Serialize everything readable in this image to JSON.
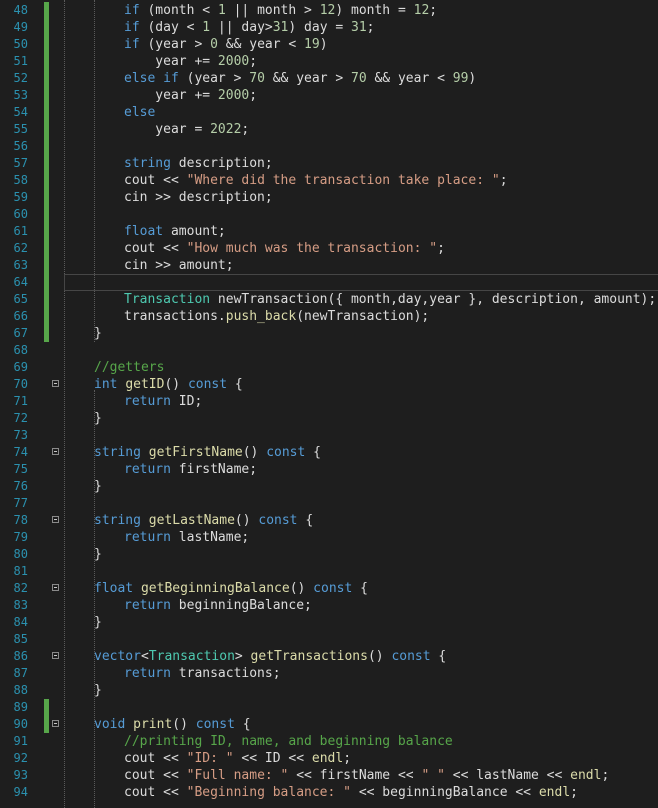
{
  "editor": {
    "colors": {
      "background": "#1e1e1e",
      "line_number": "#2b91af",
      "keyword": "#569cd6",
      "type": "#4ec9b0",
      "function": "#dcdcaa",
      "number": "#b5cea8",
      "string": "#d69d85",
      "comment": "#57a64a",
      "plain": "#dcdcdc",
      "change_bar": "#57a64a"
    },
    "line_numbers": [
      "48",
      "49",
      "50",
      "51",
      "52",
      "53",
      "54",
      "55",
      "56",
      "57",
      "58",
      "59",
      "60",
      "61",
      "62",
      "63",
      "64",
      "65",
      "66",
      "67",
      "68",
      "69",
      "70",
      "71",
      "72",
      "73",
      "74",
      "75",
      "76",
      "77",
      "78",
      "79",
      "80",
      "81",
      "82",
      "83",
      "84",
      "85",
      "86",
      "87",
      "88",
      "89",
      "90",
      "91",
      "92",
      "93",
      "94"
    ],
    "lines": [
      [
        [
          "kw",
          "if"
        ],
        [
          "pl",
          " (month < "
        ],
        [
          "num",
          "1"
        ],
        [
          "pl",
          " || month > "
        ],
        [
          "num",
          "12"
        ],
        [
          "pl",
          ") month = "
        ],
        [
          "num",
          "12"
        ],
        [
          "pl",
          ";"
        ]
      ],
      [
        [
          "kw",
          "if"
        ],
        [
          "pl",
          " (day < "
        ],
        [
          "num",
          "1"
        ],
        [
          "pl",
          " || day>"
        ],
        [
          "num",
          "31"
        ],
        [
          "pl",
          ") day = "
        ],
        [
          "num",
          "31"
        ],
        [
          "pl",
          ";"
        ]
      ],
      [
        [
          "kw",
          "if"
        ],
        [
          "pl",
          " (year > "
        ],
        [
          "num",
          "0"
        ],
        [
          "pl",
          " && year < "
        ],
        [
          "num",
          "19"
        ],
        [
          "pl",
          ")"
        ]
      ],
      [
        [
          "pl",
          "    year += "
        ],
        [
          "num",
          "2000"
        ],
        [
          "pl",
          ";"
        ]
      ],
      [
        [
          "kw",
          "else if"
        ],
        [
          "pl",
          " (year > "
        ],
        [
          "num",
          "70"
        ],
        [
          "pl",
          " && year > "
        ],
        [
          "num",
          "70"
        ],
        [
          "pl",
          " && year < "
        ],
        [
          "num",
          "99"
        ],
        [
          "pl",
          ")"
        ]
      ],
      [
        [
          "pl",
          "    year += "
        ],
        [
          "num",
          "2000"
        ],
        [
          "pl",
          ";"
        ]
      ],
      [
        [
          "kw",
          "else"
        ]
      ],
      [
        [
          "pl",
          "    year = "
        ],
        [
          "num",
          "2022"
        ],
        [
          "pl",
          ";"
        ]
      ],
      [],
      [
        [
          "kw",
          "string"
        ],
        [
          "pl",
          " description;"
        ]
      ],
      [
        [
          "pl",
          "cout << "
        ],
        [
          "str",
          "\"Where did the transaction take place: \""
        ],
        [
          "pl",
          ";"
        ]
      ],
      [
        [
          "pl",
          "cin >> description;"
        ]
      ],
      [],
      [
        [
          "kw",
          "float"
        ],
        [
          "pl",
          " amount;"
        ]
      ],
      [
        [
          "pl",
          "cout << "
        ],
        [
          "str",
          "\"How much was the transaction: \""
        ],
        [
          "pl",
          ";"
        ]
      ],
      [
        [
          "pl",
          "cin >> amount;"
        ]
      ],
      [],
      [
        [
          "ty",
          "Transaction"
        ],
        [
          "pl",
          " newTransaction({ month,day,year }, description, amount);"
        ]
      ],
      [
        [
          "pl",
          "transactions."
        ],
        [
          "fn",
          "push_back"
        ],
        [
          "pl",
          "(newTransaction);"
        ]
      ],
      [
        [
          "pl",
          "}"
        ]
      ],
      [],
      [
        [
          "cm",
          "//getters"
        ]
      ],
      [
        [
          "kw",
          "int"
        ],
        [
          "pl",
          " "
        ],
        [
          "fn",
          "getID"
        ],
        [
          "pl",
          "() "
        ],
        [
          "kw",
          "const"
        ],
        [
          "pl",
          " {"
        ]
      ],
      [
        [
          "kw",
          "return"
        ],
        [
          "pl",
          " ID;"
        ]
      ],
      [
        [
          "pl",
          "}"
        ]
      ],
      [],
      [
        [
          "kw",
          "string"
        ],
        [
          "pl",
          " "
        ],
        [
          "fn",
          "getFirstName"
        ],
        [
          "pl",
          "() "
        ],
        [
          "kw",
          "const"
        ],
        [
          "pl",
          " {"
        ]
      ],
      [
        [
          "kw",
          "return"
        ],
        [
          "pl",
          " firstName;"
        ]
      ],
      [
        [
          "pl",
          "}"
        ]
      ],
      [],
      [
        [
          "kw",
          "string"
        ],
        [
          "pl",
          " "
        ],
        [
          "fn",
          "getLastName"
        ],
        [
          "pl",
          "() "
        ],
        [
          "kw",
          "const"
        ],
        [
          "pl",
          " {"
        ]
      ],
      [
        [
          "kw",
          "return"
        ],
        [
          "pl",
          " lastName;"
        ]
      ],
      [
        [
          "pl",
          "}"
        ]
      ],
      [],
      [
        [
          "kw",
          "float"
        ],
        [
          "pl",
          " "
        ],
        [
          "fn",
          "getBeginningBalance"
        ],
        [
          "pl",
          "() "
        ],
        [
          "kw",
          "const"
        ],
        [
          "pl",
          " {"
        ]
      ],
      [
        [
          "kw",
          "return"
        ],
        [
          "pl",
          " beginningBalance;"
        ]
      ],
      [
        [
          "pl",
          "}"
        ]
      ],
      [],
      [
        [
          "kw",
          "vector"
        ],
        [
          "pl",
          "<"
        ],
        [
          "ty",
          "Transaction"
        ],
        [
          "pl",
          "> "
        ],
        [
          "fn",
          "getTransactions"
        ],
        [
          "pl",
          "() "
        ],
        [
          "kw",
          "const"
        ],
        [
          "pl",
          " {"
        ]
      ],
      [
        [
          "kw",
          "return"
        ],
        [
          "pl",
          " transactions;"
        ]
      ],
      [
        [
          "pl",
          "}"
        ]
      ],
      [],
      [
        [
          "kw",
          "void"
        ],
        [
          "pl",
          " "
        ],
        [
          "fn",
          "print"
        ],
        [
          "pl",
          "() "
        ],
        [
          "kw",
          "const"
        ],
        [
          "pl",
          " {"
        ]
      ],
      [
        [
          "cm",
          "//printing ID, name, and beginning balance"
        ]
      ],
      [
        [
          "pl",
          "cout << "
        ],
        [
          "str",
          "\"ID: \""
        ],
        [
          "pl",
          " << ID << "
        ],
        [
          "fn",
          "endl"
        ],
        [
          "pl",
          ";"
        ]
      ],
      [
        [
          "pl",
          "cout << "
        ],
        [
          "str",
          "\"Full name: \""
        ],
        [
          "pl",
          " << firstName << "
        ],
        [
          "str",
          "\" \""
        ],
        [
          "pl",
          " << lastName << "
        ],
        [
          "fn",
          "endl"
        ],
        [
          "pl",
          ";"
        ]
      ],
      [
        [
          "pl",
          "cout << "
        ],
        [
          "str",
          "\"Beginning balance: \""
        ],
        [
          "pl",
          " << beginningBalance << "
        ],
        [
          "fn",
          "endl"
        ],
        [
          "pl",
          ";"
        ]
      ]
    ]
  }
}
